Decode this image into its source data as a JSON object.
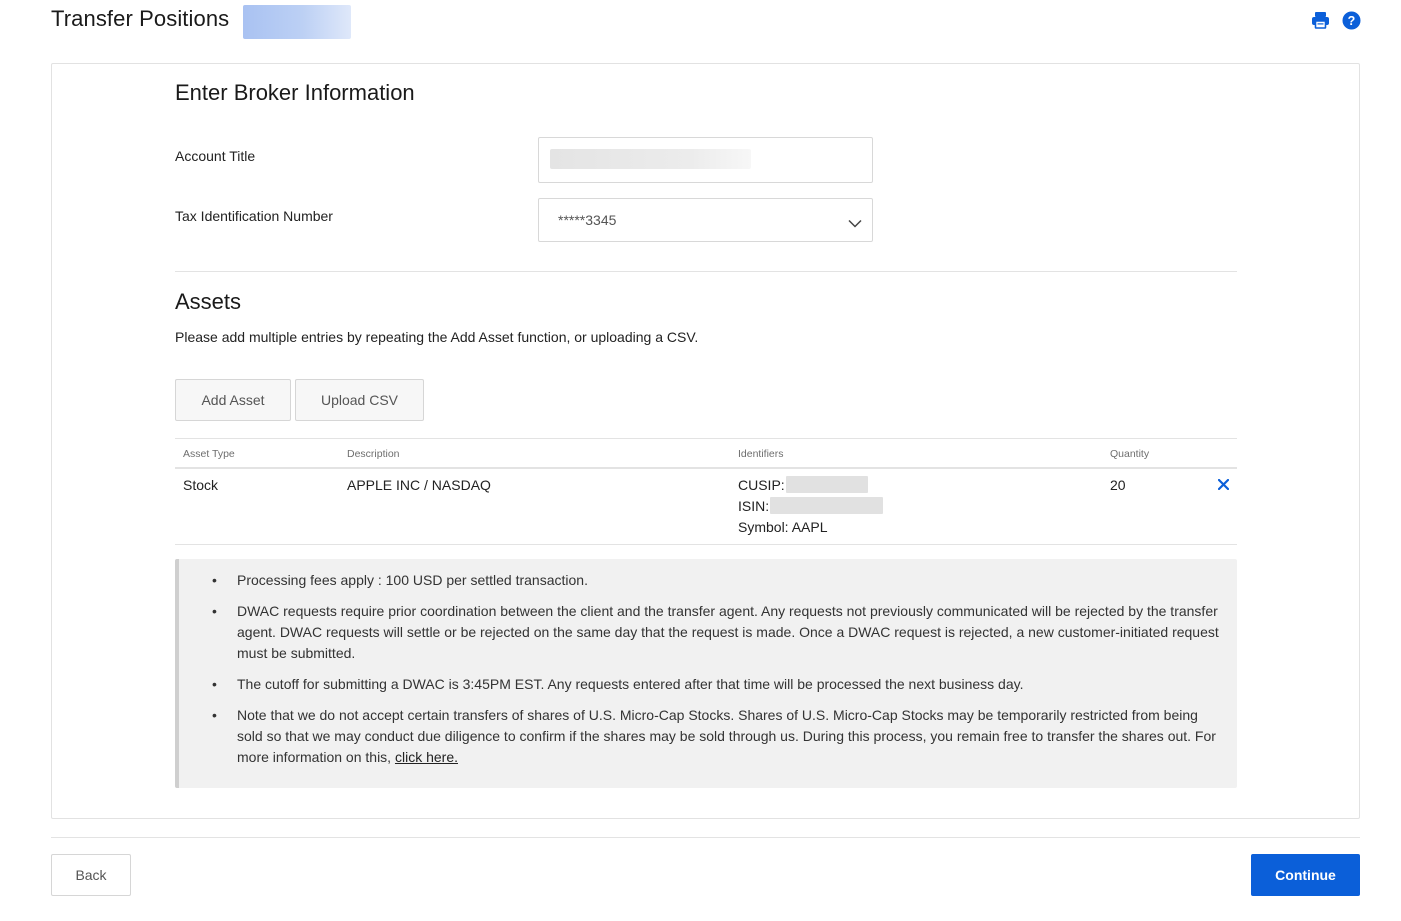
{
  "header": {
    "title": "Transfer Positions",
    "icons": [
      "printer-icon",
      "help-icon"
    ]
  },
  "broker": {
    "heading": "Enter Broker Information",
    "account_title_label": "Account Title",
    "tax_id_label": "Tax Identification Number",
    "tax_id_value": "*****3345"
  },
  "assets": {
    "heading": "Assets",
    "description": "Please add multiple entries by repeating the Add Asset function, or uploading a CSV.",
    "add_asset_label": "Add Asset",
    "upload_csv_label": "Upload CSV",
    "columns": [
      "Asset Type",
      "Description",
      "Identifiers",
      "Quantity"
    ],
    "rows": [
      {
        "asset_type": "Stock",
        "description": "APPLE INC / NASDAQ",
        "cusip_label": "CUSIP:",
        "isin_label": "ISIN:",
        "symbol": "Symbol: AAPL",
        "quantity": "20"
      }
    ]
  },
  "notes": {
    "items": [
      "Processing fees apply : 100 USD per settled transaction.",
      "DWAC requests require prior coordination between the client and the transfer agent. Any requests not previously communicated will be rejected by the transfer agent. DWAC requests will settle or be rejected on the same day that the request is made. Once a DWAC request is rejected, a new customer-initiated request must be submitted.",
      "The cutoff for submitting a DWAC is 3:45PM EST. Any requests entered after that time will be processed the next business day.",
      "Note that we do not accept certain transfers of shares of U.S. Micro-Cap Stocks. Shares of U.S. Micro-Cap Stocks may be temporarily restricted from being sold so that we may conduct due diligence to confirm if the shares may be sold through us. During this process, you remain free to transfer the shares out. For more information on this, "
    ],
    "link_text": "click here."
  },
  "footer": {
    "back_label": "Back",
    "continue_label": "Continue"
  },
  "colors": {
    "primary": "#0b5fd9",
    "icon_blue": "#0b5fd9"
  }
}
